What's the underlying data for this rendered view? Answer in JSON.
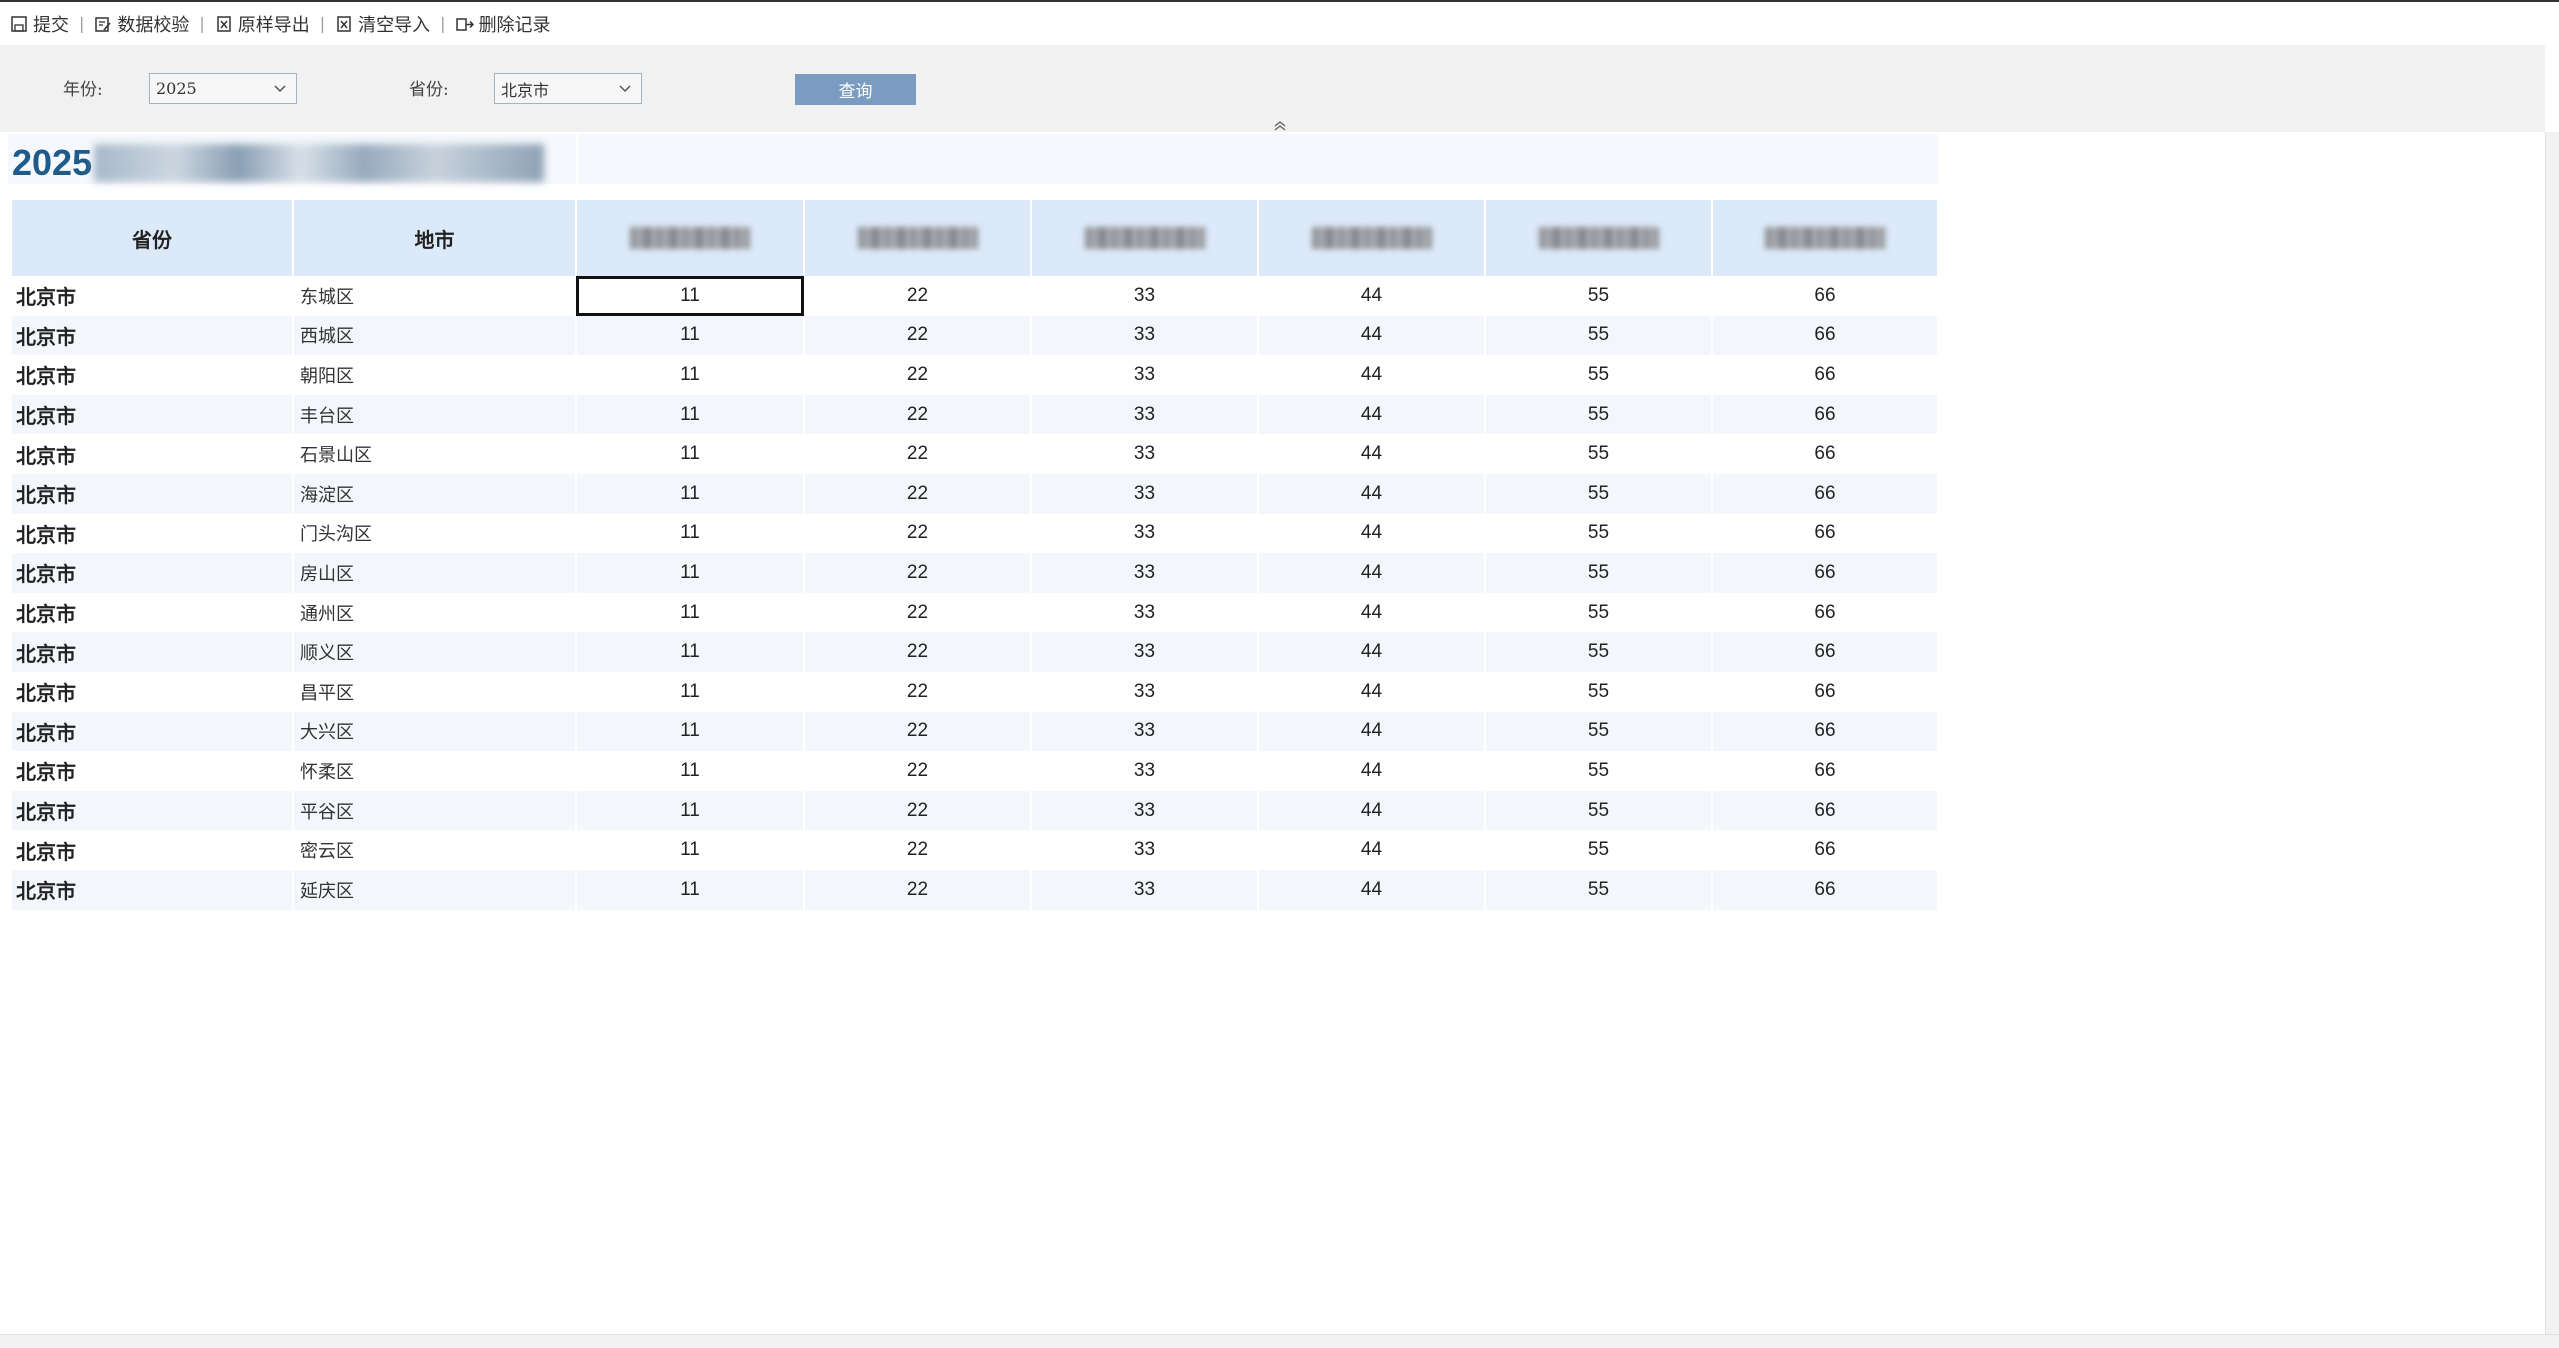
{
  "toolbar": {
    "submit_label": "提交",
    "validate_label": "数据校验",
    "export_label": "原样导出",
    "clear_import_label": "清空导入",
    "delete_label": "删除记录",
    "separator": "|"
  },
  "filters": {
    "year_label": "年份:",
    "year_value": "2025",
    "province_label": "省份:",
    "province_value": "北京市",
    "query_label": "查询"
  },
  "report": {
    "title_prefix": "2025",
    "columns": [
      "省份",
      "地市"
    ],
    "rows": [
      {
        "province": "北京市",
        "city": "东城区",
        "v": [
          "11",
          "22",
          "33",
          "44",
          "55",
          "66"
        ]
      },
      {
        "province": "北京市",
        "city": "西城区",
        "v": [
          "11",
          "22",
          "33",
          "44",
          "55",
          "66"
        ]
      },
      {
        "province": "北京市",
        "city": "朝阳区",
        "v": [
          "11",
          "22",
          "33",
          "44",
          "55",
          "66"
        ]
      },
      {
        "province": "北京市",
        "city": "丰台区",
        "v": [
          "11",
          "22",
          "33",
          "44",
          "55",
          "66"
        ]
      },
      {
        "province": "北京市",
        "city": "石景山区",
        "v": [
          "11",
          "22",
          "33",
          "44",
          "55",
          "66"
        ]
      },
      {
        "province": "北京市",
        "city": "海淀区",
        "v": [
          "11",
          "22",
          "33",
          "44",
          "55",
          "66"
        ]
      },
      {
        "province": "北京市",
        "city": "门头沟区",
        "v": [
          "11",
          "22",
          "33",
          "44",
          "55",
          "66"
        ]
      },
      {
        "province": "北京市",
        "city": "房山区",
        "v": [
          "11",
          "22",
          "33",
          "44",
          "55",
          "66"
        ]
      },
      {
        "province": "北京市",
        "city": "通州区",
        "v": [
          "11",
          "22",
          "33",
          "44",
          "55",
          "66"
        ]
      },
      {
        "province": "北京市",
        "city": "顺义区",
        "v": [
          "11",
          "22",
          "33",
          "44",
          "55",
          "66"
        ]
      },
      {
        "province": "北京市",
        "city": "昌平区",
        "v": [
          "11",
          "22",
          "33",
          "44",
          "55",
          "66"
        ]
      },
      {
        "province": "北京市",
        "city": "大兴区",
        "v": [
          "11",
          "22",
          "33",
          "44",
          "55",
          "66"
        ]
      },
      {
        "province": "北京市",
        "city": "怀柔区",
        "v": [
          "11",
          "22",
          "33",
          "44",
          "55",
          "66"
        ]
      },
      {
        "province": "北京市",
        "city": "平谷区",
        "v": [
          "11",
          "22",
          "33",
          "44",
          "55",
          "66"
        ]
      },
      {
        "province": "北京市",
        "city": "密云区",
        "v": [
          "11",
          "22",
          "33",
          "44",
          "55",
          "66"
        ]
      },
      {
        "province": "北京市",
        "city": "延庆区",
        "v": [
          "11",
          "22",
          "33",
          "44",
          "55",
          "66"
        ]
      }
    ]
  },
  "colors": {
    "header_bg": "#dce9f8",
    "alt_row_bg": "#f3f6fb",
    "query_button": "#7a9cc0",
    "title": "#1e5a8a"
  }
}
